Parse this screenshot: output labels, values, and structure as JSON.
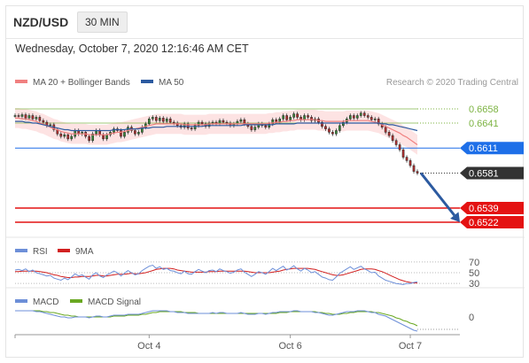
{
  "header": {
    "symbol": "NZD/USD",
    "timeframe": "30 MIN",
    "datetime": "Wednesday, October 7, 2020 12:16:46 AM CET"
  },
  "colors": {
    "ma20": "#f08080",
    "ma50": "#2c5aa0",
    "bollinger_fill": "#fde3e3",
    "green_level": "#7cb342",
    "blue_level": "#1e6fe8",
    "current_level": "#333333",
    "red_level": "#e41212",
    "arrow": "#2c5aa0",
    "rsi": "#6d8fd8",
    "rsi_ma": "#d22020",
    "macd": "#6d8fd8",
    "macd_signal": "#6aa822"
  },
  "chart_data": [
    {
      "type": "line",
      "name": "price",
      "legend": [
        {
          "label": "MA 20 + Bollinger Bands",
          "color": "#f08080"
        },
        {
          "label": "MA 50",
          "color": "#2c5aa0"
        }
      ],
      "copyright": "Research © 2020 Trading Central",
      "ylim": [
        0.6505,
        0.6675
      ],
      "x_tick_labels": [
        {
          "label": "Oct 4",
          "index": 38
        },
        {
          "label": "Oct 6",
          "index": 78
        },
        {
          "label": "Oct 7",
          "index": 112
        }
      ],
      "levels": [
        {
          "value": 0.6658,
          "label": "0.6658",
          "style": "green-dotted"
        },
        {
          "value": 0.6641,
          "label": "0.6641",
          "style": "green-dotted"
        },
        {
          "value": 0.6611,
          "label": "0.6611",
          "style": "blue-line"
        },
        {
          "value": 0.6581,
          "label": "0.6581",
          "style": "current"
        },
        {
          "value": 0.6539,
          "label": "0.6539",
          "style": "red-line"
        },
        {
          "value": 0.6522,
          "label": "0.6522",
          "style": "red-line"
        }
      ],
      "closes": [
        0.665,
        0.6649,
        0.6651,
        0.6647,
        0.665,
        0.6646,
        0.6648,
        0.6644,
        0.6642,
        0.6638,
        0.6639,
        0.6633,
        0.6628,
        0.6625,
        0.6627,
        0.6622,
        0.6625,
        0.6632,
        0.6628,
        0.663,
        0.6625,
        0.662,
        0.6628,
        0.6632,
        0.6627,
        0.6622,
        0.6627,
        0.663,
        0.6634,
        0.6632,
        0.6625,
        0.663,
        0.6636,
        0.6632,
        0.6628,
        0.663,
        0.6636,
        0.664,
        0.6646,
        0.6648,
        0.6644,
        0.6647,
        0.6643,
        0.6646,
        0.6642,
        0.6641,
        0.6638,
        0.6636,
        0.664,
        0.6635,
        0.6634,
        0.6638,
        0.6642,
        0.664,
        0.6637,
        0.6641,
        0.6642,
        0.664,
        0.6644,
        0.6642,
        0.6641,
        0.6638,
        0.664,
        0.6643,
        0.6645,
        0.664,
        0.6637,
        0.6633,
        0.6636,
        0.664,
        0.6638,
        0.6636,
        0.664,
        0.6645,
        0.6642,
        0.6646,
        0.665,
        0.6645,
        0.6648,
        0.6652,
        0.6648,
        0.6645,
        0.665,
        0.6648,
        0.6644,
        0.6646,
        0.6642,
        0.6637,
        0.6634,
        0.663,
        0.6628,
        0.6632,
        0.6638,
        0.6642,
        0.6646,
        0.665,
        0.6647,
        0.665,
        0.6653,
        0.665,
        0.6648,
        0.6645,
        0.6646,
        0.664,
        0.6636,
        0.663,
        0.6626,
        0.662,
        0.6615,
        0.6609,
        0.66,
        0.6596,
        0.659,
        0.6583,
        0.6581
      ],
      "ma20": [
        0.6647,
        0.6647,
        0.6646,
        0.6646,
        0.6645,
        0.6644,
        0.6643,
        0.6641,
        0.664,
        0.6638,
        0.6636,
        0.6634,
        0.6633,
        0.6631,
        0.663,
        0.6629,
        0.6628,
        0.6628,
        0.6628,
        0.6628,
        0.6628,
        0.6627,
        0.6627,
        0.6627,
        0.6627,
        0.6627,
        0.6627,
        0.6628,
        0.6629,
        0.663,
        0.663,
        0.6631,
        0.6632,
        0.6633,
        0.6634,
        0.6635,
        0.6636,
        0.6637,
        0.6638,
        0.6639,
        0.664,
        0.664,
        0.664,
        0.664,
        0.664,
        0.664,
        0.664,
        0.664,
        0.6639,
        0.6639,
        0.6639,
        0.6639,
        0.6639,
        0.6639,
        0.6639,
        0.664,
        0.664,
        0.664,
        0.664,
        0.664,
        0.664,
        0.664,
        0.664,
        0.664,
        0.664,
        0.664,
        0.664,
        0.664,
        0.664,
        0.664,
        0.664,
        0.664,
        0.6641,
        0.6641,
        0.6642,
        0.6642,
        0.6643,
        0.6643,
        0.6644,
        0.6644,
        0.6645,
        0.6645,
        0.6645,
        0.6645,
        0.6645,
        0.6645,
        0.6644,
        0.6644,
        0.6643,
        0.6643,
        0.6643,
        0.6643,
        0.6643,
        0.6643,
        0.6644,
        0.6644,
        0.6644,
        0.6644,
        0.6644,
        0.6644,
        0.6644,
        0.6643,
        0.6642,
        0.6641,
        0.6639,
        0.6637,
        0.6635,
        0.6633,
        0.6631,
        0.6629,
        0.6626,
        0.6624,
        0.6621,
        0.6618,
        0.6615
      ],
      "ma50": [
        0.6643,
        0.6643,
        0.6643,
        0.6642,
        0.6642,
        0.6641,
        0.6641,
        0.664,
        0.6639,
        0.6638,
        0.6637,
        0.6636,
        0.6635,
        0.6634,
        0.6633,
        0.6633,
        0.6632,
        0.6632,
        0.6632,
        0.6632,
        0.6632,
        0.6632,
        0.6632,
        0.6632,
        0.6632,
        0.6632,
        0.6632,
        0.6632,
        0.6633,
        0.6633,
        0.6633,
        0.6633,
        0.6634,
        0.6634,
        0.6634,
        0.6634,
        0.6635,
        0.6635,
        0.6635,
        0.6636,
        0.6636,
        0.6636,
        0.6636,
        0.6637,
        0.6637,
        0.6637,
        0.6637,
        0.6637,
        0.6637,
        0.6637,
        0.6637,
        0.6637,
        0.6637,
        0.6637,
        0.6638,
        0.6638,
        0.6638,
        0.6638,
        0.6638,
        0.6638,
        0.6638,
        0.6638,
        0.6638,
        0.6638,
        0.6638,
        0.6639,
        0.6639,
        0.6639,
        0.6639,
        0.6639,
        0.6639,
        0.6639,
        0.6639,
        0.6639,
        0.664,
        0.664,
        0.664,
        0.664,
        0.664,
        0.664,
        0.6641,
        0.6641,
        0.6641,
        0.6641,
        0.6641,
        0.6641,
        0.6641,
        0.6641,
        0.6641,
        0.6641,
        0.6641,
        0.6641,
        0.6641,
        0.6641,
        0.6641,
        0.6641,
        0.6641,
        0.6641,
        0.6641,
        0.6641,
        0.6641,
        0.6641,
        0.6641,
        0.6641,
        0.664,
        0.664,
        0.6639,
        0.6639,
        0.6638,
        0.6637,
        0.6636,
        0.6635,
        0.6634,
        0.6633,
        0.6632
      ],
      "bb_width": 0.0012,
      "forecast": {
        "from_value": 0.6581,
        "to_value": 0.6522
      }
    },
    {
      "type": "line",
      "name": "rsi",
      "legend": [
        {
          "label": "RSI",
          "color": "#6d8fd8"
        },
        {
          "label": "9MA",
          "color": "#d22020"
        }
      ],
      "ylim": [
        27,
        73
      ],
      "levels": [
        70,
        50,
        30
      ],
      "level_labels": [
        "70",
        "50",
        "30"
      ],
      "rsi": [
        55,
        56,
        54,
        57,
        52,
        55,
        50,
        48,
        46,
        44,
        45,
        40,
        38,
        36,
        40,
        37,
        42,
        48,
        44,
        46,
        42,
        38,
        46,
        50,
        44,
        41,
        46,
        49,
        53,
        50,
        44,
        49,
        54,
        50,
        46,
        48,
        54,
        58,
        62,
        64,
        58,
        61,
        56,
        58,
        54,
        53,
        50,
        48,
        53,
        48,
        47,
        52,
        56,
        53,
        50,
        54,
        55,
        52,
        57,
        54,
        52,
        49,
        51,
        55,
        57,
        51,
        47,
        43,
        47,
        52,
        50,
        47,
        52,
        58,
        54,
        58,
        62,
        55,
        58,
        63,
        57,
        53,
        58,
        55,
        50,
        52,
        47,
        42,
        40,
        37,
        36,
        42,
        49,
        53,
        57,
        61,
        56,
        59,
        62,
        57,
        54,
        50,
        51,
        44,
        40,
        36,
        34,
        32,
        30,
        29,
        28,
        30,
        30,
        32,
        33
      ],
      "ma9": [
        52,
        52,
        53,
        53,
        53,
        53,
        53,
        52,
        51,
        50,
        48,
        46,
        45,
        43,
        42,
        41,
        41,
        42,
        42,
        43,
        43,
        43,
        44,
        45,
        45,
        44,
        44,
        45,
        46,
        47,
        47,
        47,
        48,
        49,
        48,
        48,
        49,
        50,
        52,
        54,
        56,
        57,
        58,
        58,
        58,
        57,
        55,
        54,
        53,
        52,
        51,
        51,
        51,
        51,
        51,
        52,
        52,
        52,
        53,
        53,
        53,
        53,
        53,
        53,
        53,
        53,
        52,
        51,
        50,
        50,
        50,
        50,
        50,
        51,
        52,
        53,
        55,
        56,
        57,
        58,
        58,
        58,
        58,
        58,
        57,
        56,
        54,
        52,
        50,
        48,
        46,
        45,
        45,
        46,
        48,
        50,
        52,
        54,
        56,
        57,
        57,
        57,
        56,
        54,
        52,
        49,
        46,
        43,
        40,
        37,
        35,
        33,
        32,
        31,
        31
      ]
    },
    {
      "type": "line",
      "name": "macd",
      "legend": [
        {
          "label": "MACD",
          "color": "#6d8fd8"
        },
        {
          "label": "MACD Signal",
          "color": "#6aa822"
        }
      ],
      "zero_label": "0",
      "ylim": [
        -0.0022,
        0.0006
      ],
      "macd": [
        0.0003,
        0.0003,
        0.0003,
        0.0003,
        0.0003,
        0.0003,
        0.0002,
        0.0002,
        0.0001,
        0.0,
        -0.0001,
        -0.0002,
        -0.0003,
        -0.0004,
        -0.0004,
        -0.0005,
        -0.0005,
        -0.0004,
        -0.0004,
        -0.0004,
        -0.0004,
        -0.0005,
        -0.0004,
        -0.0003,
        -0.0003,
        -0.0004,
        -0.0004,
        -0.0003,
        -0.0002,
        -0.0002,
        -0.0002,
        -0.0002,
        -0.0001,
        -0.0001,
        -0.0001,
        -0.0001,
        0.0,
        0.0001,
        0.0002,
        0.0003,
        0.0003,
        0.0003,
        0.0003,
        0.0003,
        0.0002,
        0.0002,
        0.0001,
        0.0001,
        0.0001,
        0.0,
        0.0,
        0.0,
        0.0,
        0.0,
        0.0,
        0.0,
        0.0001,
        0.0,
        0.0001,
        0.0001,
        0.0,
        0.0,
        0.0,
        0.0,
        0.0001,
        0.0,
        -0.0001,
        -0.0001,
        -0.0001,
        0.0,
        0.0,
        -0.0001,
        0.0,
        0.0001,
        0.0001,
        0.0002,
        0.0002,
        0.0002,
        0.0002,
        0.0003,
        0.0003,
        0.0002,
        0.0002,
        0.0002,
        0.0002,
        0.0001,
        0.0001,
        0.0,
        -0.0001,
        -0.0002,
        -0.0002,
        -0.0001,
        0.0,
        0.0001,
        0.0002,
        0.0002,
        0.0002,
        0.0003,
        0.0003,
        0.0003,
        0.0002,
        0.0001,
        0.0001,
        -0.0001,
        -0.0002,
        -0.0003,
        -0.0005,
        -0.0007,
        -0.0009,
        -0.0011,
        -0.0013,
        -0.0015,
        -0.0017,
        -0.0019,
        -0.002
      ],
      "signal": [
        0.0003,
        0.0003,
        0.0003,
        0.0003,
        0.0003,
        0.0003,
        0.0003,
        0.0003,
        0.0002,
        0.0002,
        0.0001,
        0.0001,
        0.0,
        -0.0001,
        -0.0002,
        -0.0002,
        -0.0003,
        -0.0003,
        -0.0004,
        -0.0004,
        -0.0004,
        -0.0004,
        -0.0004,
        -0.0004,
        -0.0004,
        -0.0004,
        -0.0004,
        -0.0004,
        -0.0003,
        -0.0003,
        -0.0003,
        -0.0003,
        -0.0002,
        -0.0002,
        -0.0002,
        -0.0002,
        -0.0001,
        -0.0001,
        0.0,
        0.0001,
        0.0001,
        0.0002,
        0.0002,
        0.0002,
        0.0002,
        0.0002,
        0.0002,
        0.0002,
        0.0001,
        0.0001,
        0.0001,
        0.0001,
        0.0,
        0.0,
        0.0,
        0.0,
        0.0,
        0.0,
        0.0,
        0.0,
        0.0,
        0.0,
        0.0,
        0.0,
        0.0,
        0.0,
        0.0,
        0.0,
        0.0,
        0.0,
        0.0,
        0.0,
        0.0,
        0.0,
        0.0,
        0.0001,
        0.0001,
        0.0001,
        0.0002,
        0.0002,
        0.0002,
        0.0002,
        0.0002,
        0.0002,
        0.0002,
        0.0002,
        0.0001,
        0.0001,
        0.0,
        0.0,
        -0.0001,
        -0.0001,
        -0.0001,
        0.0,
        0.0,
        0.0001,
        0.0001,
        0.0002,
        0.0002,
        0.0002,
        0.0002,
        0.0002,
        0.0001,
        0.0001,
        0.0,
        -0.0001,
        -0.0002,
        -0.0003,
        -0.0005,
        -0.0006,
        -0.0008,
        -0.0009,
        -0.0011,
        -0.0012,
        -0.0014
      ]
    }
  ]
}
